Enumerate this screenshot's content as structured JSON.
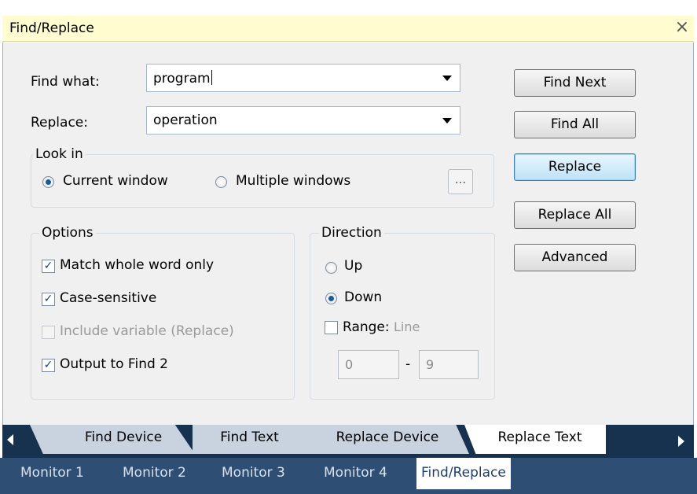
{
  "window": {
    "title": "Find/Replace"
  },
  "find_what": {
    "label": "Find what:",
    "value": "program"
  },
  "replace": {
    "label": "Replace:",
    "value": "operation"
  },
  "look_in": {
    "title": "Look in",
    "options": [
      {
        "label": "Current window",
        "selected": true
      },
      {
        "label": "Multiple windows",
        "selected": false
      }
    ],
    "browse_label": "..."
  },
  "options": {
    "title": "Options",
    "items": [
      {
        "label": "Match whole word only",
        "checked": true,
        "enabled": true
      },
      {
        "label": "Case-sensitive",
        "checked": true,
        "enabled": true
      },
      {
        "label": "Include variable (Replace)",
        "checked": false,
        "enabled": false
      },
      {
        "label": "Output to Find 2",
        "checked": true,
        "enabled": true
      }
    ]
  },
  "direction": {
    "title": "Direction",
    "options": [
      {
        "label": "Up",
        "selected": false
      },
      {
        "label": "Down",
        "selected": true
      }
    ],
    "range_label": "Range:",
    "range_unit": "Line",
    "range_checked": false,
    "range_from": "0",
    "range_sep": "-",
    "range_to": "9"
  },
  "buttons": {
    "find_next": "Find Next",
    "find_all": "Find All",
    "replace": "Replace",
    "replace_all": "Replace All",
    "advanced": "Advanced"
  },
  "tabs": [
    "Find Device",
    "Find Text",
    "Replace Device",
    "Replace Text"
  ],
  "active_tab": "Replace Text",
  "monitor_tabs": [
    "Monitor 1",
    "Monitor 2",
    "Monitor 3",
    "Monitor 4",
    "Find/Replace"
  ],
  "active_monitor_tab": "Find/Replace",
  "colors": {
    "title_bar": "#fffcd0",
    "tab_strip": "#17324f",
    "bottom_bar": "#2e4e73",
    "focus_button": "#bde2f7"
  }
}
